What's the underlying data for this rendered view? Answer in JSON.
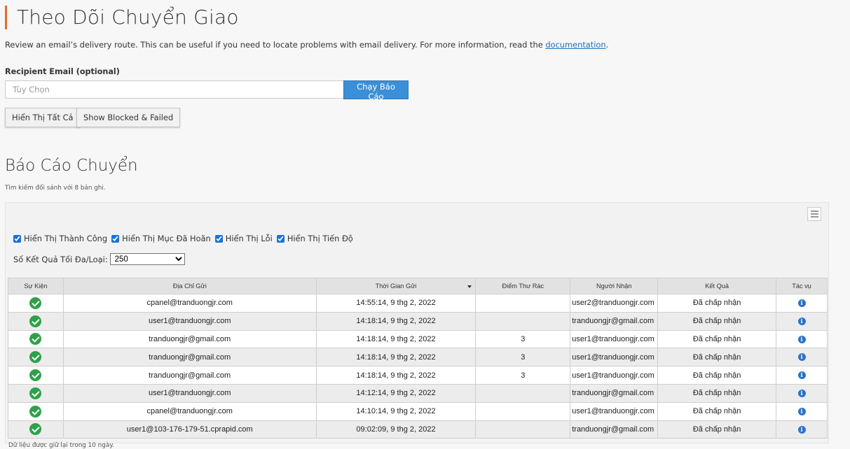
{
  "page": {
    "title": "Theo Dõi Chuyển Giao",
    "description_prefix": "Review an email’s delivery route. This can be useful if you need to locate problems with email delivery. For more information, read the",
    "description_link": "documentation",
    "description_suffix": ".",
    "accent_color": "#e8682c"
  },
  "form": {
    "recipient_label": "Recipient Email (optional)",
    "recipient_placeholder": "Tùy Chọn",
    "recipient_value": "",
    "run_button": "Chạy Báo Cáo",
    "show_all_button": "Hiển Thị Tất Cả",
    "show_blocked_button": "Show Blocked & Failed"
  },
  "report": {
    "title": "Báo Cáo Chuyển",
    "summary": "Tìm kiếm đối sánh với 8 bản ghi.",
    "list_icon": "list-view-icon",
    "filters": [
      {
        "label": "Hiển Thị Thành Công",
        "checked": true
      },
      {
        "label": "Hiển Thị Mục Đã Hoãn",
        "checked": true
      },
      {
        "label": "Hiển Thị Lỗi",
        "checked": true
      },
      {
        "label": "Hiển Thị Tiến Độ",
        "checked": true
      }
    ],
    "max_results_label": "Số Kết Quả Tối Đa/Loại:",
    "max_results_value": "250",
    "columns": {
      "event": "Sự Kiện",
      "sender": "Địa Chỉ Gửi",
      "sent_time": "Thời Gian Gửi",
      "spam_score": "Điểm Thư Rác",
      "recipient": "Người Nhận",
      "result": "Kết Quả",
      "actions": "Tác vụ"
    },
    "rows": [
      {
        "event_icon": "success-check-icon",
        "sender": "cpanel@tranduongjr.com",
        "sent_time": "14:55:14, 9 thg 2, 2022",
        "spam_score": "",
        "recipient": "user2@tranduongjr.com",
        "result": "Đã chấp nhận",
        "action_icon": "info-icon"
      },
      {
        "event_icon": "success-check-icon",
        "sender": "user1@tranduongjr.com",
        "sent_time": "14:18:14, 9 thg 2, 2022",
        "spam_score": "",
        "recipient": "tranduongjr@gmail.com",
        "result": "Đã chấp nhận",
        "action_icon": "info-icon"
      },
      {
        "event_icon": "success-check-icon",
        "sender": "tranduongjr@gmail.com",
        "sent_time": "14:18:14, 9 thg 2, 2022",
        "spam_score": "3",
        "recipient": "user1@tranduongjr.com",
        "result": "Đã chấp nhận",
        "action_icon": "info-icon"
      },
      {
        "event_icon": "success-check-icon",
        "sender": "tranduongjr@gmail.com",
        "sent_time": "14:18:14, 9 thg 2, 2022",
        "spam_score": "3",
        "recipient": "user1@tranduongjr.com",
        "result": "Đã chấp nhận",
        "action_icon": "info-icon"
      },
      {
        "event_icon": "success-check-icon",
        "sender": "tranduongjr@gmail.com",
        "sent_time": "14:18:14, 9 thg 2, 2022",
        "spam_score": "3",
        "recipient": "user1@tranduongjr.com",
        "result": "Đã chấp nhận",
        "action_icon": "info-icon"
      },
      {
        "event_icon": "success-check-icon",
        "sender": "user1@tranduongjr.com",
        "sent_time": "14:12:14, 9 thg 2, 2022",
        "spam_score": "",
        "recipient": "tranduongjr@gmail.com",
        "result": "Đã chấp nhận",
        "action_icon": "info-icon"
      },
      {
        "event_icon": "success-check-icon",
        "sender": "cpanel@tranduongjr.com",
        "sent_time": "14:10:14, 9 thg 2, 2022",
        "spam_score": "",
        "recipient": "user1@tranduongjr.com",
        "result": "Đã chấp nhận",
        "action_icon": "info-icon"
      },
      {
        "event_icon": "success-check-icon",
        "sender": "user1@103-176-179-51.cprapid.com",
        "sent_time": "09:02:09, 9 thg 2, 2022",
        "spam_score": "",
        "recipient": "tranduongjr@gmail.com",
        "result": "Đã chấp nhận",
        "action_icon": "info-icon"
      }
    ],
    "retention_note": "Dữ liệu được giữ lại trong 10 ngày."
  }
}
